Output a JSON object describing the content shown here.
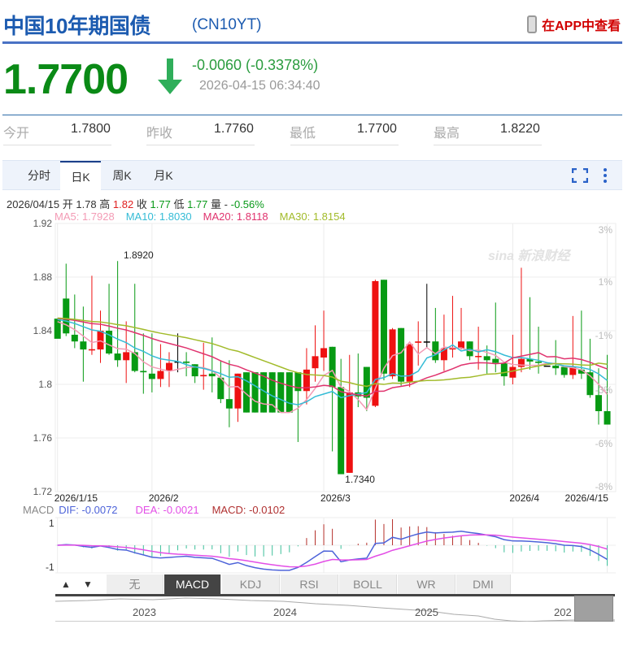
{
  "header": {
    "title": "中国10年期国债",
    "code": "(CN10YT)",
    "app_link": "在APP中查看"
  },
  "quote": {
    "price": "1.7700",
    "change": "-0.0060 (-0.3378%)",
    "time": "2026-04-15 06:34:40",
    "direction": "down"
  },
  "stats": [
    {
      "label": "今开",
      "value": "1.7800"
    },
    {
      "label": "昨收",
      "value": "1.7760"
    },
    {
      "label": "最低",
      "value": "1.7700"
    },
    {
      "label": "最高",
      "value": "1.8220"
    }
  ],
  "tabs": [
    {
      "label": "分时"
    },
    {
      "label": "日K",
      "active": true
    },
    {
      "label": "周K"
    },
    {
      "label": "月K"
    }
  ],
  "info": {
    "date": "2026/04/15",
    "open_l": "开",
    "open": "1.78",
    "high_l": "高",
    "high": "1.82",
    "close_l": "收",
    "close": "1.77",
    "low_l": "低",
    "low": "1.77",
    "vol_l": "量",
    "vol": "-",
    "pct": "-0.56%"
  },
  "ma": {
    "ma5": "MA5: 1.7928",
    "ma10": "MA10: 1.8030",
    "ma20": "MA20: 1.8118",
    "ma30": "MA30: 1.8154"
  },
  "colors": {
    "up": "#ee1111",
    "down": "#079a13",
    "ma5": "#f39bb5",
    "ma10": "#35bcd6",
    "ma20": "#e0336e",
    "ma30": "#a2bb2a",
    "dif": "#4d63d9",
    "dea": "#e34ee6"
  },
  "chart_data": {
    "type": "candlestick",
    "ylim": [
      1.72,
      1.92
    ],
    "y_ticks": [
      "1.92",
      "1.88",
      "1.84",
      "1.8",
      "1.76",
      "1.72"
    ],
    "pct_ticks": [
      "3%",
      "1%",
      "-1%",
      "-3%",
      "-6%",
      "-8%"
    ],
    "x_labels": [
      {
        "i": 0,
        "t": "2026/1/15"
      },
      {
        "i": 11,
        "t": "2026/2"
      },
      {
        "i": 31,
        "t": "2026/3"
      },
      {
        "i": 53,
        "t": "2026/4"
      },
      {
        "i": 64,
        "t": "2026/4/15"
      }
    ],
    "max_label": "1.8920",
    "min_label": "1.7340",
    "ohlc": [
      [
        1.849,
        1.864,
        1.864,
        1.834
      ],
      [
        1.864,
        1.89,
        1.836,
        1.838
      ],
      [
        1.837,
        1.867,
        1.827,
        1.832
      ],
      [
        1.832,
        1.858,
        1.802,
        1.826
      ],
      [
        1.826,
        1.881,
        1.822,
        1.8262
      ],
      [
        1.826,
        1.855,
        1.816,
        1.84
      ],
      [
        1.84,
        1.875,
        1.822,
        1.823
      ],
      [
        1.823,
        1.892,
        1.813,
        1.818
      ],
      [
        1.818,
        1.847,
        1.801,
        1.824
      ],
      [
        1.824,
        1.875,
        1.809,
        1.81
      ],
      [
        1.81,
        1.838,
        1.793,
        1.809
      ],
      [
        1.808,
        1.838,
        1.794,
        1.804
      ],
      [
        1.804,
        1.83,
        1.798,
        1.81
      ],
      [
        1.81,
        1.824,
        1.798,
        1.816
      ],
      [
        1.817,
        1.838,
        1.809,
        1.817
      ],
      [
        1.817,
        1.824,
        1.806,
        1.816
      ],
      [
        1.815,
        1.815,
        1.801,
        1.806
      ],
      [
        1.806,
        1.831,
        1.796,
        1.807
      ],
      [
        1.808,
        1.835,
        1.794,
        1.806
      ],
      [
        1.805,
        1.818,
        1.786,
        1.789
      ],
      [
        1.789,
        1.818,
        1.768,
        1.782
      ],
      [
        1.782,
        1.808,
        1.772,
        1.808
      ],
      [
        1.809,
        1.809,
        1.779,
        1.779
      ],
      [
        1.809,
        1.809,
        1.779,
        1.779
      ],
      [
        1.809,
        1.809,
        1.779,
        1.779
      ],
      [
        1.809,
        1.809,
        1.779,
        1.779
      ],
      [
        1.809,
        1.809,
        1.779,
        1.779
      ],
      [
        1.809,
        1.809,
        1.779,
        1.779
      ],
      [
        1.809,
        1.809,
        1.757,
        1.795
      ],
      [
        1.795,
        1.827,
        1.785,
        1.811
      ],
      [
        1.812,
        1.844,
        1.802,
        1.821
      ],
      [
        1.82,
        1.855,
        1.81,
        1.827
      ],
      [
        1.828,
        1.828,
        1.75,
        1.798
      ],
      [
        1.798,
        1.819,
        1.733,
        1.733
      ],
      [
        1.734,
        1.822,
        1.734,
        1.794
      ],
      [
        1.794,
        1.823,
        1.783,
        1.791
      ],
      [
        1.813,
        1.813,
        1.78,
        1.79
      ],
      [
        1.784,
        1.878,
        1.783,
        1.877
      ],
      [
        1.878,
        1.878,
        1.803,
        1.808
      ],
      [
        1.806,
        1.842,
        1.804,
        1.841
      ],
      [
        1.842,
        1.842,
        1.799,
        1.802
      ],
      [
        1.802,
        1.83,
        1.798,
        1.83
      ],
      [
        1.831,
        1.847,
        1.814,
        1.832
      ],
      [
        1.832,
        1.875,
        1.827,
        1.832
      ],
      [
        1.832,
        1.857,
        1.816,
        1.818
      ],
      [
        1.818,
        1.852,
        1.81,
        1.827
      ],
      [
        1.826,
        1.866,
        1.82,
        1.827
      ],
      [
        1.827,
        1.857,
        1.826,
        1.832
      ],
      [
        1.832,
        1.832,
        1.818,
        1.821
      ],
      [
        1.821,
        1.843,
        1.811,
        1.8212
      ],
      [
        1.821,
        1.829,
        1.808,
        1.818
      ],
      [
        1.819,
        1.861,
        1.809,
        1.816
      ],
      [
        1.816,
        1.816,
        1.799,
        1.806
      ],
      [
        1.805,
        1.837,
        1.8,
        1.813
      ],
      [
        1.813,
        1.887,
        1.809,
        1.819
      ],
      [
        1.819,
        1.865,
        1.811,
        1.817
      ],
      [
        1.817,
        1.843,
        1.808,
        1.816
      ],
      [
        1.814,
        1.814,
        1.814,
        1.814
      ],
      [
        1.814,
        1.833,
        1.807,
        1.812
      ],
      [
        1.813,
        1.813,
        1.805,
        1.807
      ],
      [
        1.807,
        1.851,
        1.804,
        1.813
      ],
      [
        1.811,
        1.855,
        1.804,
        1.808
      ],
      [
        1.809,
        1.834,
        1.79,
        1.792
      ],
      [
        1.792,
        1.812,
        1.77,
        1.78
      ],
      [
        1.78,
        1.822,
        1.77,
        1.77
      ]
    ],
    "macd": {
      "label": "MACD",
      "dif": "DIF: -0.0072",
      "dea": "DEA: -0.0021",
      "macd": "MACD: -0.0102",
      "y_ticks": [
        "1",
        "-1"
      ]
    }
  },
  "indicators": [
    "无",
    "MACD",
    "KDJ",
    "RSI",
    "BOLL",
    "WR",
    "DMI"
  ],
  "indicator_active": "MACD",
  "navigator": {
    "years": [
      "2023",
      "2024",
      "2025",
      "202"
    ]
  },
  "controls": {
    "up": "▲",
    "down": "▼"
  },
  "watermark": "sina 新浪财经"
}
